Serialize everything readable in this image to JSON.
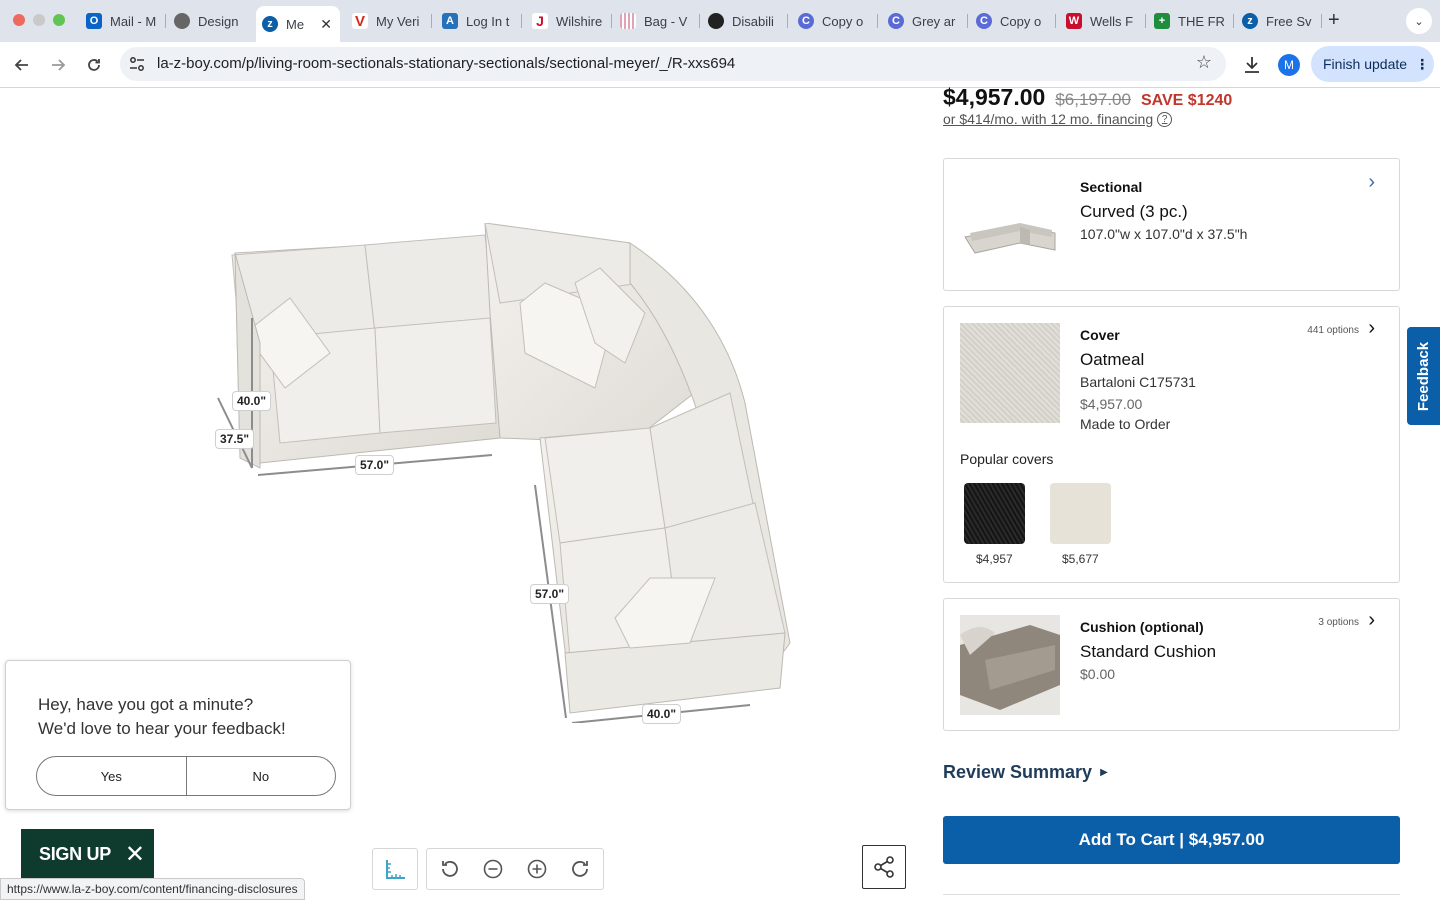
{
  "browser": {
    "tabs": [
      {
        "title": "Mail - M",
        "icon": "outlook-icon",
        "color": "#0a64c8"
      },
      {
        "title": "Design",
        "icon": "globe-icon",
        "color": "#555555"
      },
      {
        "title": "Me",
        "icon": "la-z-boy-icon",
        "color": "#0b5ea8",
        "active": true
      },
      {
        "title": "My Veri",
        "icon": "verizon-icon",
        "color": "#d52b1e"
      },
      {
        "title": "Log In t",
        "icon": "amex-icon",
        "color": "#2671b9"
      },
      {
        "title": "Wilshire",
        "icon": "j-icon",
        "color": "#c8102e"
      },
      {
        "title": "Bag - V",
        "icon": "bag-icon",
        "color": "#e0a3b8"
      },
      {
        "title": "Disabili",
        "icon": "ssa-icon",
        "color": "#222222"
      },
      {
        "title": "Copy o",
        "icon": "copy-icon",
        "color": "#5b6bd6"
      },
      {
        "title": "Grey ar",
        "icon": "copy-icon",
        "color": "#5b6bd6"
      },
      {
        "title": "Copy o",
        "icon": "copy-icon",
        "color": "#5b6bd6"
      },
      {
        "title": "Wells F",
        "icon": "wells-fargo-icon",
        "color": "#c8102e"
      },
      {
        "title": "THE FR",
        "icon": "sheets-icon",
        "color": "#1e8e3e"
      },
      {
        "title": "Free Sv",
        "icon": "la-z-boy-icon",
        "color": "#0b5ea8"
      }
    ],
    "url": "la-z-boy.com/p/living-room-sectionals-stationary-sectionals/sectional-meyer/_/R-xxs694",
    "avatar_letter": "M",
    "finish_update": "Finish update",
    "status_url": "https://www.la-z-boy.com/content/financing-disclosures"
  },
  "viewer": {
    "dimensions": [
      "40.0\"",
      "37.5\"",
      "57.0\"",
      "57.0\"",
      "40.0\""
    ]
  },
  "feedback_popup": {
    "line1": "Hey, have you got a minute?",
    "line2": "We'd love to hear your feedback!",
    "yes": "Yes",
    "no": "No"
  },
  "signup": {
    "label": "SIGN UP"
  },
  "product": {
    "price": "$4,957.00",
    "was_price": "$6,197.00",
    "save": "SAVE $1240",
    "financing": "or $414/mo. with 12 mo. financing",
    "sectional": {
      "label": "Sectional",
      "name": "Curved (3 pc.)",
      "dims": "107.0\"w x 107.0\"d x 37.5\"h"
    },
    "cover": {
      "label": "Cover",
      "options": "441 options",
      "name": "Oatmeal",
      "code": "Bartaloni C175731",
      "price": "$4,957.00",
      "status": "Made to Order",
      "popular_label": "Popular covers",
      "popular": [
        {
          "price": "$4,957",
          "color": "#1c1c1c"
        },
        {
          "price": "$5,677",
          "color": "#e6e2d8"
        }
      ]
    },
    "cushion": {
      "label": "Cushion (optional)",
      "options": "3 options",
      "name": "Standard Cushion",
      "price": "$0.00"
    },
    "review_summary": "Review Summary",
    "add_to_cart": "Add To Cart  |  $4,957.00",
    "feedback_tab": "Feedback"
  },
  "colors": {
    "brand_blue": "#0b5ea8",
    "save_red": "#c0362c",
    "signup_green": "#0e3b2e"
  }
}
